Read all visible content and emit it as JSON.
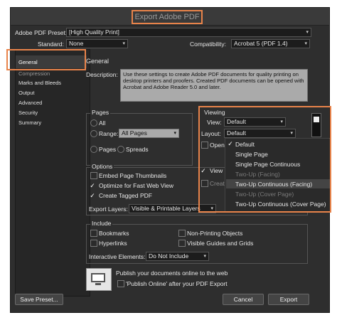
{
  "window": {
    "title": "Export Adobe PDF"
  },
  "preset": {
    "label": "Adobe PDF Preset:",
    "value": "[High Quality Print]"
  },
  "standard": {
    "label": "Standard:",
    "value": "None"
  },
  "compatibility": {
    "label": "Compatibility:",
    "value": "Acrobat 5 (PDF 1.4)"
  },
  "sidebar": {
    "items": [
      "General",
      "Compression",
      "Marks and Bleeds",
      "Output",
      "Advanced",
      "Security",
      "Summary"
    ]
  },
  "section": {
    "title": "General"
  },
  "description": {
    "label": "Description:",
    "text": "Use these settings to create Adobe PDF documents for quality printing on desktop printers and proofers.  Created PDF documents can be opened with Acrobat and Adobe Reader 5.0 and later."
  },
  "pages": {
    "title": "Pages",
    "all": "All",
    "range": "Range:",
    "range_value": "All Pages",
    "pages": "Pages",
    "spreads": "Spreads"
  },
  "viewing": {
    "title": "Viewing",
    "view_label": "View:",
    "view_value": "Default",
    "layout_label": "Layout:",
    "layout_value": "Default",
    "open_partial": "Open",
    "view_partial": "View F",
    "create_partial": "Create"
  },
  "layout_menu": {
    "items": [
      "Default",
      "Single Page",
      "Single Page Continuous",
      "Two-Up (Facing)",
      "Two-Up Continuous (Facing)",
      "Two-Up (Cover Page)",
      "Two-Up Continuous (Cover Page)"
    ]
  },
  "options": {
    "title": "Options",
    "embed": "Embed Page Thumbnails",
    "optimize": "Optimize for Fast Web View",
    "tagged": "Create Tagged PDF",
    "export_layers_label": "Export Layers:",
    "export_layers_value": "Visible & Printable Layers"
  },
  "include": {
    "title": "Include",
    "bookmarks": "Bookmarks",
    "hyperlinks": "Hyperlinks",
    "non_printing": "Non-Printing Objects",
    "visible_guides": "Visible Guides and Grids",
    "interactive_label": "Interactive Elements:",
    "interactive_value": "Do Not Include"
  },
  "publish": {
    "heading": "Publish your documents online to the web",
    "checkbox": "'Publish Online' after your PDF Export"
  },
  "buttons": {
    "save_preset": "Save Preset...",
    "cancel": "Cancel",
    "export": "Export"
  }
}
